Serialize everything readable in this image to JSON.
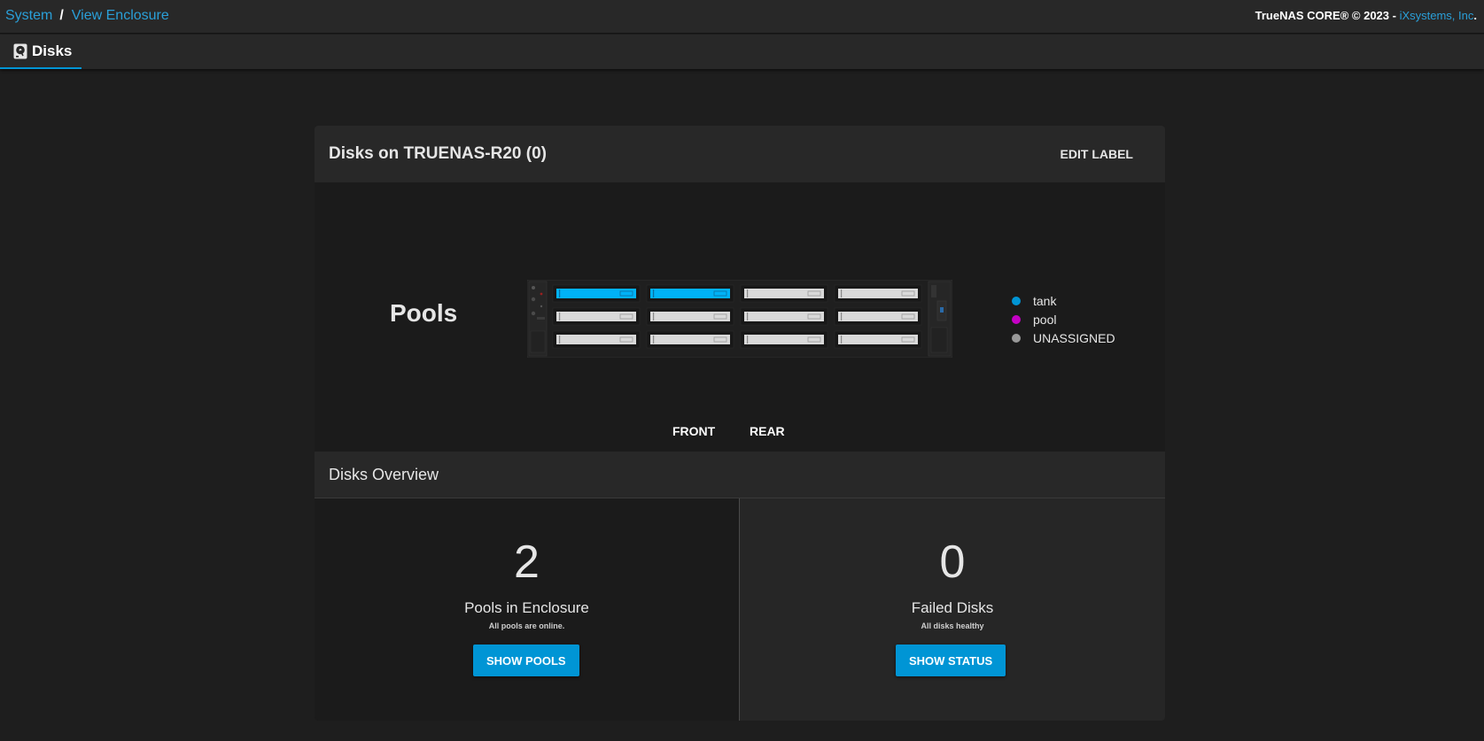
{
  "breadcrumb": {
    "items": [
      "System",
      "View Enclosure"
    ],
    "separator": "/"
  },
  "copyright": {
    "prefix": "TrueNAS CORE® © 2023 - ",
    "company": "iXsystems, Inc",
    "suffix": "."
  },
  "tab": {
    "label": "Disks",
    "icon": "hard-disk-icon"
  },
  "enclosure": {
    "title": "Disks on TRUENAS-R20 (0)",
    "edit_label": "EDIT LABEL",
    "pools_label": "Pools",
    "views": {
      "front": "FRONT",
      "rear": "REAR"
    }
  },
  "legend": [
    {
      "label": "tank",
      "color": "#0095d5"
    },
    {
      "label": "pool",
      "color": "#c500c5"
    },
    {
      "label": "UNASSIGNED",
      "color": "#999999"
    }
  ],
  "slots": [
    {
      "status": "tank"
    },
    {
      "status": "tank"
    },
    {
      "status": "unassigned"
    },
    {
      "status": "unassigned"
    },
    {
      "status": "unassigned"
    },
    {
      "status": "unassigned"
    },
    {
      "status": "unassigned"
    },
    {
      "status": "unassigned"
    },
    {
      "status": "unassigned"
    },
    {
      "status": "unassigned"
    },
    {
      "status": "unassigned"
    },
    {
      "status": "unassigned"
    }
  ],
  "colors": {
    "accent": "#0095d5",
    "link": "#2a9fd8",
    "tank_disk": "#00b2f7",
    "unassigned_disk": "#d9d9d9"
  },
  "overview": {
    "title": "Disks Overview",
    "pools": {
      "value": "2",
      "label": "Pools in Enclosure",
      "sub": "All pools are online.",
      "button": "SHOW POOLS"
    },
    "failed": {
      "value": "0",
      "label": "Failed Disks",
      "sub": "All disks healthy",
      "button": "SHOW STATUS"
    }
  }
}
